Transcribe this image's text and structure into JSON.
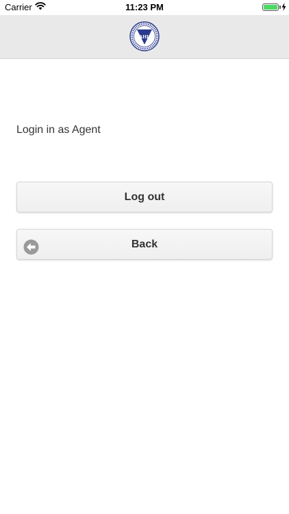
{
  "status_bar": {
    "carrier": "Carrier",
    "time": "11:23 PM",
    "battery_level_percent": 100,
    "wifi_icon": "wifi-icon",
    "charging_icon": "bolt-icon"
  },
  "header": {
    "logo_letters": "AHL",
    "logo_icon": "ahl-logo-seal"
  },
  "main": {
    "login_status": "Login in as Agent",
    "logout_label": "Log out",
    "back_label": "Back",
    "back_icon": "arrow-left-circle-icon"
  },
  "colors": {
    "header_bg": "#e9e9e9",
    "button_bg": "#f3f3f3",
    "logo_blue": "#2a3a8c",
    "battery_green": "#4cd964",
    "back_icon_gray": "#9a9a9a"
  }
}
